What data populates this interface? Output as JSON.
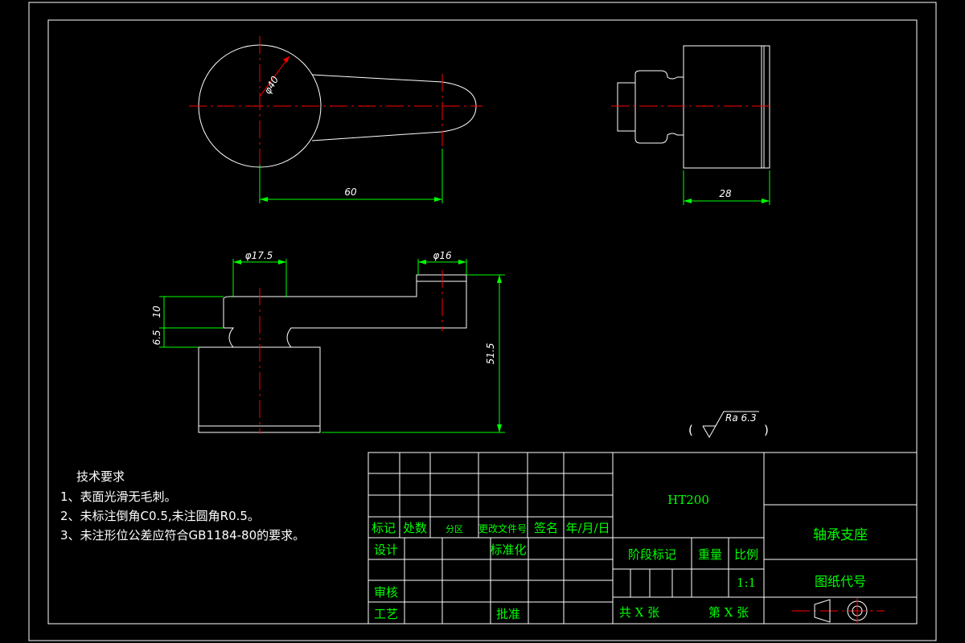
{
  "colors": {
    "background": "#000000",
    "outline": "#ffffff",
    "dimension": "#00ff00",
    "centerline": "#ff0000",
    "title_text": "#00ff00"
  },
  "dimensions": {
    "diameter_40": "φ40",
    "length_60": "60",
    "width_28": "28",
    "diameter_17_5": "φ17.5",
    "diameter_16": "φ16",
    "height_10": "10",
    "height_6_5": "6.5",
    "height_51_5": "51.5"
  },
  "surface_finish": {
    "open": "(",
    "label": "Ra 6.3",
    "close": ")"
  },
  "technical_requirements": {
    "title": "技术要求",
    "items": [
      "1、表面光滑无毛刺。",
      "2、未标注倒角C0.5,未注圆角R0.5。",
      "3、未注形位公差应符合GB1184-80的要求。"
    ]
  },
  "title_block": {
    "headers": [
      "标记",
      "处数",
      "分区",
      "更改文件号",
      "签名",
      "年/月/日"
    ],
    "design": "设计",
    "standardization": "标准化",
    "review": "审核",
    "process": "工艺",
    "approve": "批准",
    "material": "HT200",
    "stage_mark": "阶段标记",
    "weight": "重量",
    "scale_label": "比例",
    "scale_value": "1:1",
    "sheets_total": "共 X 张",
    "sheet_number": "第 X 张",
    "part_name": "轴承支座",
    "drawing_code_label": "图纸代号",
    "projection_symbol": "first-angle-projection-icon"
  }
}
